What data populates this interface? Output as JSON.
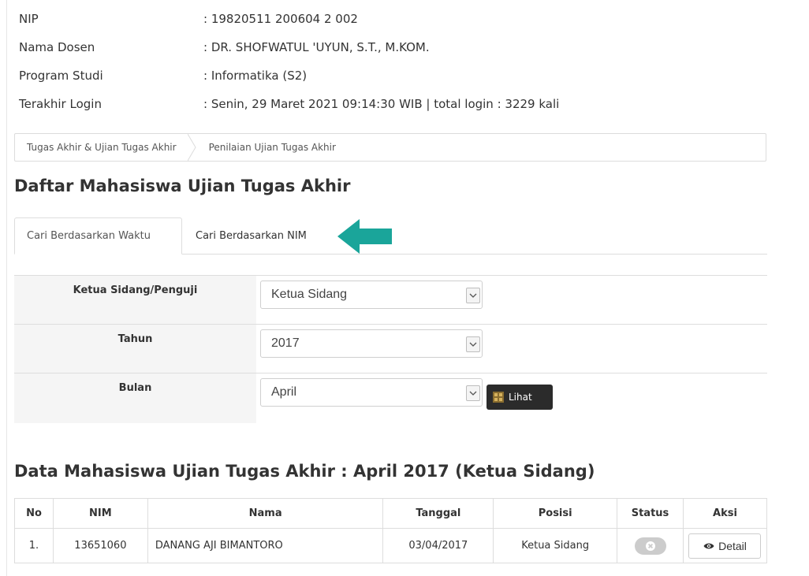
{
  "info": {
    "rows": [
      {
        "label": "NIP",
        "value": ": 19820511 200604 2 002"
      },
      {
        "label": "Nama Dosen",
        "value": ": DR. SHOFWATUL 'UYUN, S.T., M.KOM."
      },
      {
        "label": "Program Studi",
        "value": ": Informatika (S2)"
      },
      {
        "label": "Terakhir Login",
        "value": ": Senin, 29 Maret 2021 09:14:30 WIB | total login : 3229 kali"
      }
    ]
  },
  "breadcrumb": {
    "items": [
      "Tugas Akhir & Ujian Tugas Akhir",
      "Penilaian Ujian Tugas Akhir"
    ]
  },
  "page_title": "Daftar Mahasiswa Ujian Tugas Akhir",
  "tabs": [
    {
      "label": "Cari Berdasarkan Waktu",
      "active": true
    },
    {
      "label": "Cari Berdasarkan NIM",
      "active": false
    }
  ],
  "arrow_color": "#1aa59a",
  "form": {
    "ketua": {
      "label": "Ketua Sidang/Penguji",
      "value": "Ketua Sidang"
    },
    "tahun": {
      "label": "Tahun",
      "value": "2017"
    },
    "bulan": {
      "label": "Bulan",
      "value": "April"
    },
    "lihat_label": "Lihat"
  },
  "data_title": "Data Mahasiswa Ujian Tugas Akhir : April 2017 (Ketua Sidang)",
  "table": {
    "headers": [
      "No",
      "NIM",
      "Nama",
      "Tanggal",
      "Posisi",
      "Status",
      "Aksi"
    ],
    "rows": [
      {
        "no": "1.",
        "nim": "13651060",
        "nama": "DANANG AJI BIMANTORO",
        "tanggal": "03/04/2017",
        "posisi": "Ketua Sidang",
        "status": "close-icon",
        "aksi": "Detail"
      }
    ]
  }
}
